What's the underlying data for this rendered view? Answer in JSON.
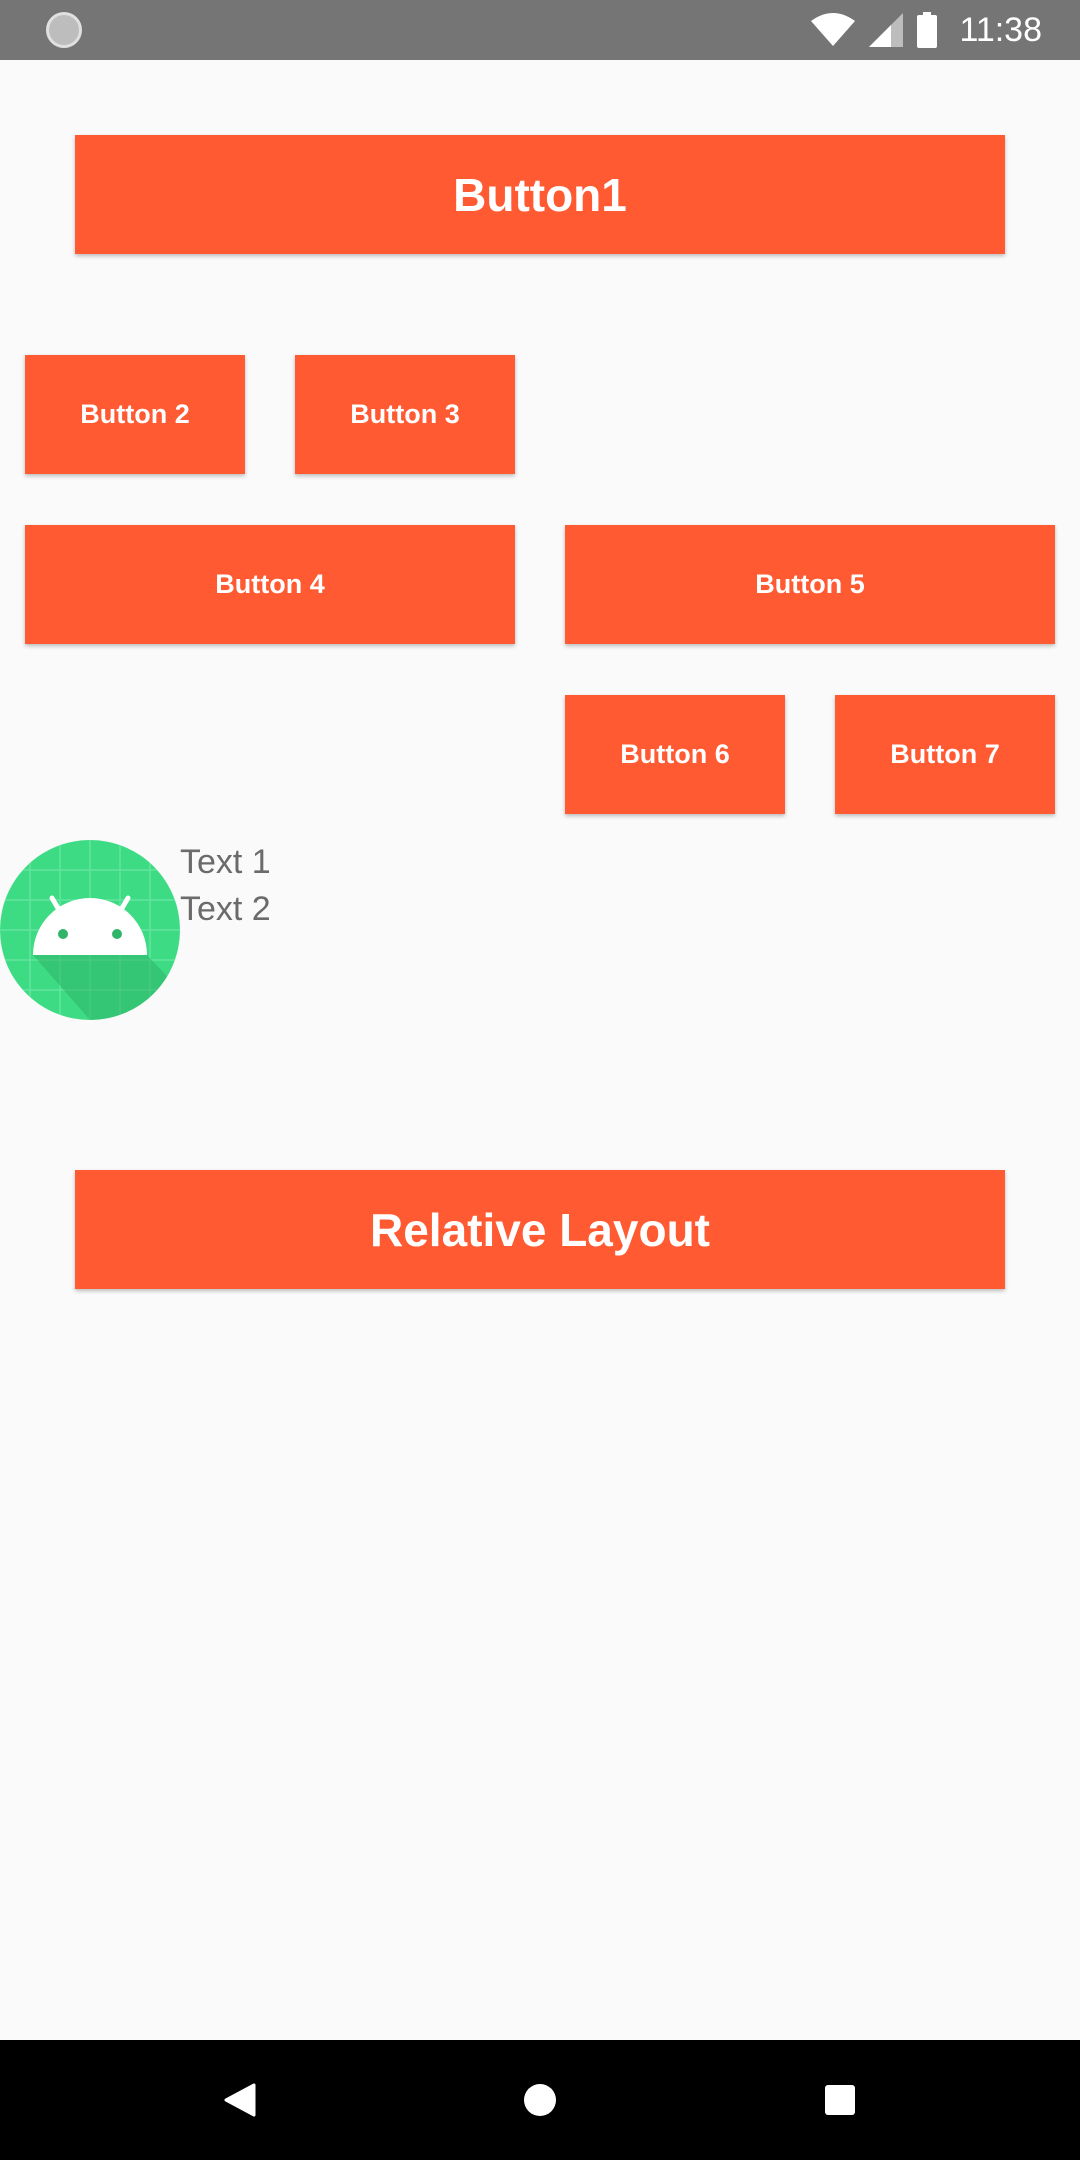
{
  "status_bar": {
    "time": "11:38",
    "icons": [
      "app-notification-icon",
      "wifi-icon",
      "signal-icon",
      "battery-icon"
    ],
    "background": "#757575"
  },
  "buttons": {
    "button1": "Button1",
    "button2": "Button 2",
    "button3": "Button 3",
    "button4": "Button 4",
    "button5": "Button 5",
    "button6": "Button 6",
    "button7": "Button 7",
    "relative_layout": "Relative Layout"
  },
  "profile": {
    "icon": "android-icon",
    "text1": "Text 1",
    "text2": "Text 2"
  },
  "nav_bar": {
    "icons": [
      "back-icon",
      "home-icon",
      "recents-icon"
    ]
  },
  "colors": {
    "accent": "#ff5a32",
    "background": "#fafafa",
    "android_green": "#3ddc84"
  }
}
